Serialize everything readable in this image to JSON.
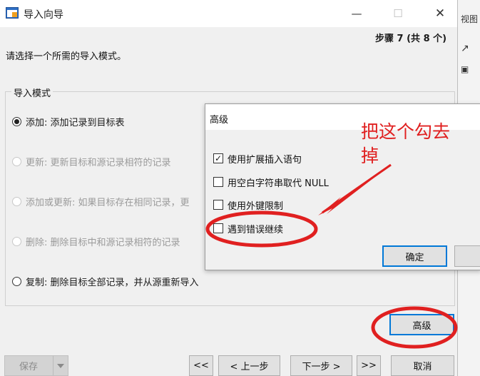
{
  "wizard": {
    "title": "导入向导",
    "step": "步骤 7 (共 8 个)",
    "instruction": "请选择一个所需的导入模式。",
    "group_title": "导入模式",
    "modes": [
      {
        "label": "添加: 添加记录到目标表",
        "selected": true,
        "enabled": true
      },
      {
        "label": "更新: 更新目标和源记录相符的记录",
        "selected": false,
        "enabled": false
      },
      {
        "label": "添加或更新: 如果目标存在相同记录，更",
        "selected": false,
        "enabled": false
      },
      {
        "label": "删除: 删除目标中和源记录相符的记录",
        "selected": false,
        "enabled": false
      },
      {
        "label": "复制: 删除目标全部记录，并从源重新导入",
        "selected": false,
        "enabled": true
      }
    ],
    "buttons": {
      "advanced": "高级",
      "save": "保存",
      "first": "<<",
      "prev": "< 上一步",
      "next": "下一步 >",
      "last": ">>",
      "cancel": "取消"
    }
  },
  "advanced_dialog": {
    "title": "高级",
    "options": [
      {
        "label": "使用扩展插入语句",
        "checked": true
      },
      {
        "label": "用空白字符串取代 NULL",
        "checked": false
      },
      {
        "label": "使用外键限制",
        "checked": false
      },
      {
        "label": "遇到错误继续",
        "checked": false
      }
    ],
    "ok": "确定"
  },
  "annotation": {
    "text": "把这个勾去掉",
    "color": "#e02020"
  },
  "background_fragments": [
    "视图"
  ],
  "colors": {
    "accent": "#0078d7",
    "window_bg": "#f0f0f0",
    "annotation": "#e02020"
  }
}
